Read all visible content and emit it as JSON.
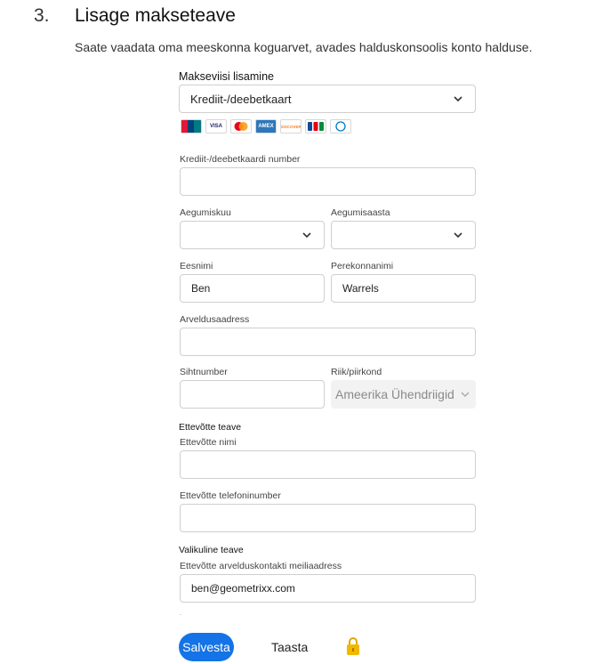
{
  "step": {
    "number": "3.",
    "title": "Lisage makseteave",
    "subtitle": "Saate vaadata oma meeskonna koguarvet, avades halduskonsoolis konto halduse."
  },
  "payment": {
    "method_label": "Makseviisi lisamine",
    "method_value": "Krediit-/deebetkaart",
    "card_brands": [
      "union-pay",
      "visa",
      "mastercard",
      "amex",
      "discover",
      "jcb",
      "diners-club"
    ],
    "card_brand_texts": {
      "union-pay": "UnionPay",
      "visa": "VISA",
      "amex": "AMEX",
      "discover": "DISCOVER",
      "jcb": "JCB",
      "diners": "Diners Club"
    }
  },
  "form": {
    "card_number_label": "Krediit-/deebetkaardi number",
    "card_number_value": "",
    "exp_month_label": "Aegumiskuu",
    "exp_year_label": "Aegumisaasta",
    "first_name_label": "Eesnimi",
    "first_name_value": "Ben",
    "last_name_label": "Perekonnanimi",
    "last_name_value": "Warrels",
    "address_label": "Arveldusaadress",
    "address_value": "",
    "zip_label": "Sihtnumber",
    "zip_value": "",
    "country_label": "Riik/piirkond",
    "country_value": "Ameerika Ühendriigid"
  },
  "company": {
    "section_title": "Ettevõtte teave",
    "name_label": "Ettevõtte nimi",
    "name_value": "",
    "phone_label": "Ettevõtte telefoninumber",
    "phone_value": ""
  },
  "optional": {
    "section_title": "Valikuline teave",
    "email_label": "Ettevõtte arvelduskontakti meiliaadress",
    "email_value": "ben@geometrixx.com"
  },
  "actions": {
    "save_label": "Salvesta",
    "reset_label": "Taasta"
  },
  "colors": {
    "primary": "#1473e6",
    "lock": "#f2b800"
  }
}
